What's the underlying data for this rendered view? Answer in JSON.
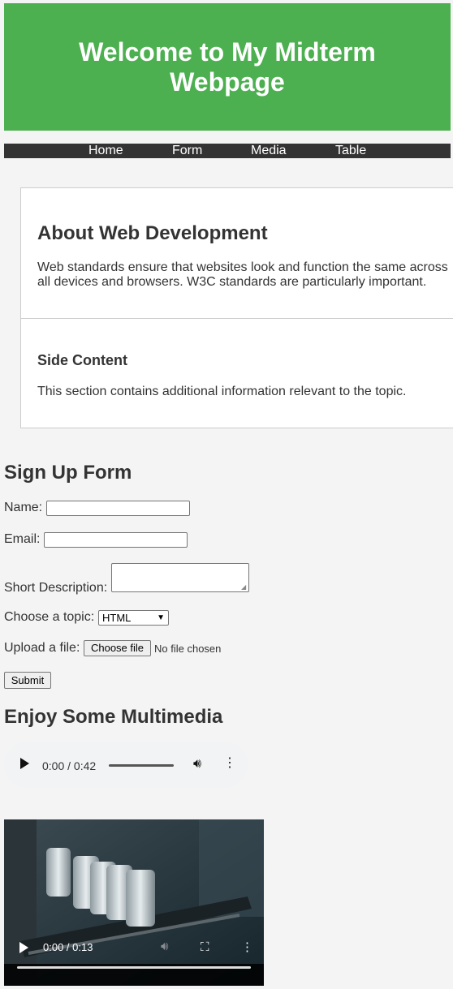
{
  "header": {
    "title": "Welcome to My Midterm Webpage"
  },
  "nav": {
    "items": [
      "Home",
      "Form",
      "Media",
      "Table"
    ]
  },
  "about": {
    "heading": "About Web Development",
    "text": "Web standards ensure that websites look and function the same across all devices and browsers. W3C standards are particularly important."
  },
  "side": {
    "heading": "Side Content",
    "text": "This section contains additional information relevant to the topic."
  },
  "form": {
    "title": "Sign Up Form",
    "name_label": "Name:",
    "email_label": "Email:",
    "description_label": "Short Description:",
    "topic_label": "Choose a topic:",
    "topic_selected": "HTML",
    "file_label": "Upload a file:",
    "file_button": "Choose file",
    "file_status": "No file chosen",
    "submit_label": "Submit"
  },
  "media": {
    "title": "Enjoy Some Multimedia",
    "audio": {
      "time": "0:00 / 0:42"
    },
    "video": {
      "time": "0:00 / 0:13"
    }
  },
  "colors": {
    "header_bg": "#4caf50",
    "nav_bg": "#333333",
    "page_bg": "#f4f4f4"
  }
}
